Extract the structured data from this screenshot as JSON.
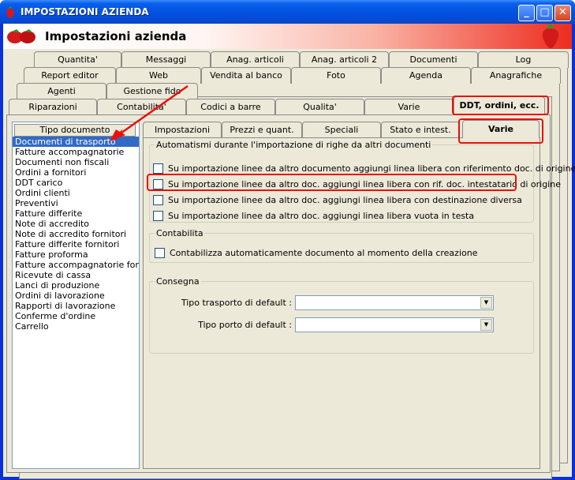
{
  "window": {
    "title": "IMPOSTAZIONI AZIENDA",
    "buttons": [
      "_",
      "□",
      "✕"
    ]
  },
  "header": {
    "title": "Impostazioni azienda"
  },
  "outer_tabs": {
    "row1": [
      "Quantita'",
      "Messaggi",
      "Anag. articoli",
      "Anag. articoli 2",
      "Documenti",
      "Log"
    ],
    "row2": [
      "Report editor",
      "Web",
      "Vendita al banco",
      "Foto",
      "Agenda",
      "Anagrafiche"
    ],
    "row3": [
      "Agenti",
      "Gestione fido"
    ],
    "row4": [
      "Riparazioni",
      "Contabilita'",
      "Codici a barre",
      "Qualita'",
      "Varie",
      "DDT, ordini, ecc."
    ],
    "active": "DDT, ordini, ecc."
  },
  "doc_list": {
    "header": "Tipo documento",
    "items": [
      "Documenti di trasporto",
      "Fatture accompagnatorie",
      "Documenti non fiscali",
      "Ordini a fornitori",
      "DDT carico",
      "Ordini clienti",
      "Preventivi",
      "Fatture differite",
      "Note di accredito",
      "Note di accredito fornitori",
      "Fatture differite fornitori",
      "Fatture proforma",
      "Fatture accompagnatorie fornitori",
      "Ricevute di cassa",
      "Lanci di produzione",
      "Ordini di lavorazione",
      "Rapporti di lavorazione",
      "Conferme d'ordine",
      "Carrello"
    ],
    "selected": "Documenti di trasporto"
  },
  "inner_tabs": {
    "items": [
      "Impostazioni",
      "Prezzi e quant.",
      "Speciali",
      "Stato e intest.",
      "Varie"
    ],
    "active": "Varie"
  },
  "automatismi": {
    "legend": "Automatismi durante l'importazione di righe da altri documenti",
    "options": [
      {
        "label": "Su importazione linee da altro documento aggiungi linea libera con riferimento doc. di origine",
        "checked": false
      },
      {
        "label": "Su importazione linee da altro doc. aggiungi linea libera con rif. doc. intestatario di origine",
        "checked": false
      },
      {
        "label": "Su importazione linee da altro doc. aggiungi linea libera con destinazione diversa",
        "checked": false
      },
      {
        "label": "Su importazione linee da altro doc. aggiungi linea libera vuota in testa",
        "checked": false
      }
    ]
  },
  "contabilita": {
    "legend": "Contabilita",
    "option": {
      "label": "Contabilizza automaticamente documento al momento della creazione",
      "checked": false
    }
  },
  "consegna": {
    "legend": "Consegna",
    "trasporto_label": "Tipo trasporto di default :",
    "trasporto_value": "",
    "porto_label": "Tipo porto di default :",
    "porto_value": ""
  },
  "colors": {
    "titlebar": "#0a5fe8",
    "highlight": "#e81010",
    "selection": "#316ac5",
    "arrow": "#e81010"
  },
  "icons": [
    "strawberry-icon",
    "close-icon",
    "maximize-icon",
    "minimize-icon",
    "dropdown-arrow-icon"
  ]
}
